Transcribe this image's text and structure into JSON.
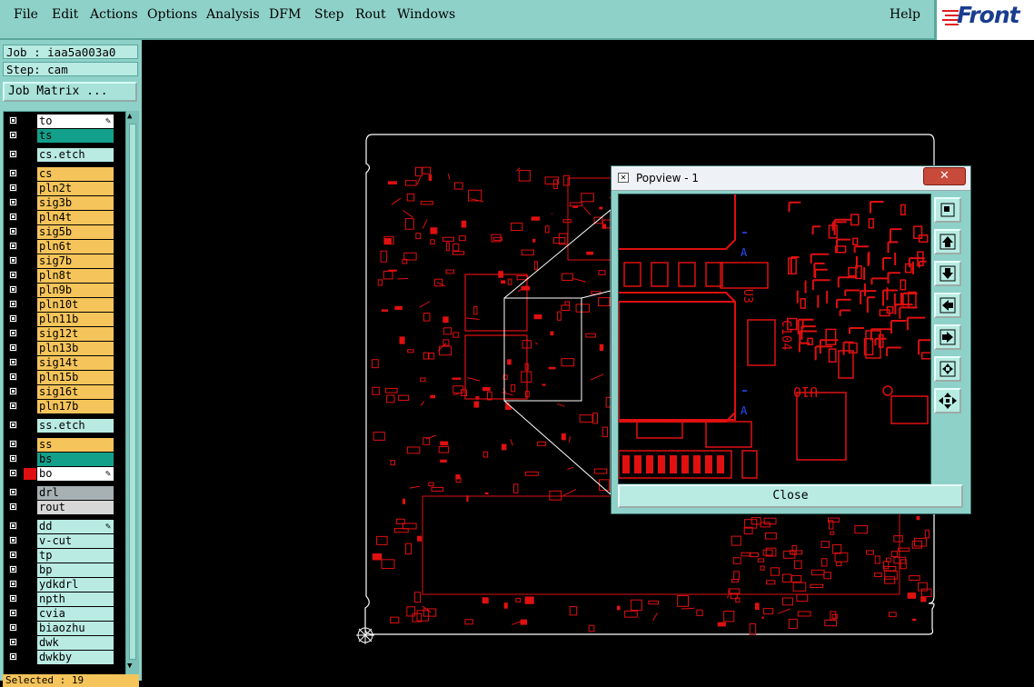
{
  "menu": {
    "items": [
      "File",
      "Edit",
      "Actions",
      "Options",
      "Analysis",
      "DFM",
      "Step",
      "Rout",
      "Windows"
    ],
    "underline": [
      "F",
      "E",
      "A",
      "O",
      "",
      "",
      "S",
      "R",
      "W"
    ],
    "help": "Help",
    "logo": "Front"
  },
  "job": {
    "job_label": "Job : iaa5a003a0",
    "step_label": "Step: cam",
    "matrix_button": "Job Matrix ..."
  },
  "layers": [
    {
      "name": "to",
      "color": "#ffffff",
      "pen": true
    },
    {
      "name": "ts",
      "color": "#13a08a"
    },
    {
      "name": "cs.etch",
      "color": "#b9ebe3",
      "gap": true
    },
    {
      "name": "cs",
      "color": "#f5c45a",
      "gap": true
    },
    {
      "name": "pln2t",
      "color": "#f5c45a"
    },
    {
      "name": "sig3b",
      "color": "#f5c45a"
    },
    {
      "name": "pln4t",
      "color": "#f5c45a"
    },
    {
      "name": "sig5b",
      "color": "#f5c45a"
    },
    {
      "name": "pln6t",
      "color": "#f5c45a"
    },
    {
      "name": "sig7b",
      "color": "#f5c45a"
    },
    {
      "name": "pln8t",
      "color": "#f5c45a"
    },
    {
      "name": "pln9b",
      "color": "#f5c45a"
    },
    {
      "name": "pln10t",
      "color": "#f5c45a"
    },
    {
      "name": "pln11b",
      "color": "#f5c45a"
    },
    {
      "name": "sig12t",
      "color": "#f5c45a"
    },
    {
      "name": "pln13b",
      "color": "#f5c45a"
    },
    {
      "name": "sig14t",
      "color": "#f5c45a"
    },
    {
      "name": "pln15b",
      "color": "#f5c45a"
    },
    {
      "name": "sig16t",
      "color": "#f5c45a"
    },
    {
      "name": "pln17b",
      "color": "#f5c45a"
    },
    {
      "name": "ss.etch",
      "color": "#b9ebe3",
      "gap": true
    },
    {
      "name": "ss",
      "color": "#f5c45a",
      "gap": true
    },
    {
      "name": "bs",
      "color": "#13a08a"
    },
    {
      "name": "bo",
      "color": "#ffffff",
      "pen": true,
      "selected": true
    },
    {
      "name": "drl",
      "color": "#a7b1b3",
      "gap": true
    },
    {
      "name": "rout",
      "color": "#d7d7d7"
    },
    {
      "name": "dd",
      "color": "#b9ebe3",
      "pen": true,
      "gap": true
    },
    {
      "name": "v-cut",
      "color": "#b9ebe3"
    },
    {
      "name": "tp",
      "color": "#b9ebe3"
    },
    {
      "name": "bp",
      "color": "#b9ebe3"
    },
    {
      "name": "ydkdrl",
      "color": "#b9ebe3"
    },
    {
      "name": "npth",
      "color": "#b9ebe3"
    },
    {
      "name": "cvia",
      "color": "#b9ebe3"
    },
    {
      "name": "biaozhu",
      "color": "#b9ebe3"
    },
    {
      "name": "dwk",
      "color": "#b9ebe3"
    },
    {
      "name": "dwkby",
      "color": "#b9ebe3"
    }
  ],
  "status": {
    "selected": "Selected : 19"
  },
  "popview": {
    "title": "Popview - 1",
    "close_x": "✕",
    "close_button": "Close",
    "labels": [
      "U10",
      "C104",
      "U3"
    ]
  },
  "colors": {
    "accent": "#8ed1c8",
    "trace": "#e01010",
    "outline": "#ffffff"
  }
}
